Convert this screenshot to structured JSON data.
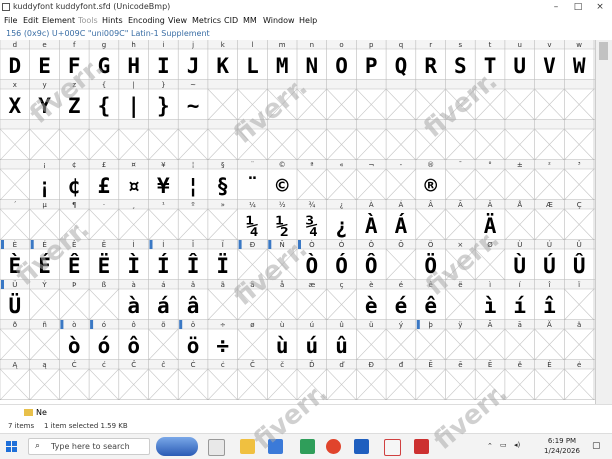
{
  "window": {
    "title": "kuddyfont  kuddyfont.sfd (UnicodeBmp)",
    "controls": [
      "–",
      "□",
      "×"
    ]
  },
  "menu": [
    "File",
    "Edit",
    "Element",
    "Tools",
    "Hints",
    "Encoding",
    "View",
    "Metrics",
    "CID",
    "MM",
    "Window",
    "Help"
  ],
  "info": "156 (0x9c) U+009C \"uni009C\" Latin-1 Supplement",
  "grid": {
    "rows": [
      {
        "labels": [
          "d",
          "e",
          "f",
          "g",
          "h",
          "i",
          "j",
          "k",
          "l",
          "m",
          "n",
          "o",
          "p",
          "q",
          "r",
          "s",
          "t",
          "u",
          "v",
          "w"
        ],
        "glyphs": [
          "D",
          "E",
          "F",
          "G",
          "H",
          "I",
          "J",
          "K",
          "L",
          "M",
          "N",
          "O",
          "P",
          "Q",
          "R",
          "S",
          "T",
          "U",
          "V",
          "W"
        ]
      },
      {
        "labels": [
          "x",
          "y",
          "z",
          "{",
          "|",
          "}",
          "~",
          "",
          "",
          "",
          "",
          "",
          "",
          "",
          "",
          "",
          "",
          "",
          "",
          ""
        ],
        "glyphs": [
          "X",
          "Y",
          "Z",
          "{",
          "|",
          "}",
          "~",
          "",
          "",
          "",
          "",
          "",
          "",
          "",
          "",
          "",
          "",
          "",
          "",
          ""
        ]
      },
      {
        "labels": [
          "",
          "",
          "",
          "",
          "",
          "",
          "",
          "",
          "",
          "",
          "",
          "",
          "",
          "",
          "",
          "",
          "",
          "",
          "",
          ""
        ],
        "glyphs": [
          "",
          "",
          "",
          "",
          "",
          "",
          "",
          "",
          "",
          "",
          "",
          "",
          "",
          "",
          "",
          "",
          "",
          "",
          "",
          ""
        ]
      },
      {
        "labels": [
          "",
          "¡",
          "¢",
          "£",
          "¤",
          "¥",
          "¦",
          "§",
          "¨",
          "©",
          "ª",
          "«",
          "¬",
          "-",
          "®",
          "¯",
          "°",
          "±",
          "²",
          "³"
        ],
        "glyphs": [
          "",
          "¡",
          "¢",
          "£",
          "¤",
          "¥",
          "¦",
          "§",
          "¨",
          "©",
          "",
          "",
          "",
          "",
          "®",
          "",
          "",
          "",
          "",
          ""
        ]
      },
      {
        "labels": [
          "´",
          "µ",
          "¶",
          "·",
          "¸",
          "¹",
          "º",
          "»",
          "¼",
          "½",
          "¾",
          "¿",
          "À",
          "Á",
          "Â",
          "Ã",
          "Ä",
          "Å",
          "Æ",
          "Ç"
        ],
        "glyphs": [
          "",
          "",
          "",
          "",
          "",
          "",
          "",
          "",
          "¼",
          "½",
          "¾",
          "¿",
          "À",
          "Á",
          "",
          "",
          "Ä",
          "",
          "",
          ""
        ]
      },
      {
        "labels": [
          "È",
          "É",
          "Ê",
          "Ë",
          "Ì",
          "Í",
          "Î",
          "Ï",
          "Ð",
          "Ñ",
          "Ò",
          "Ó",
          "Ô",
          "Õ",
          "Ö",
          "×",
          "Ø",
          "Ù",
          "Ú",
          "Û"
        ],
        "glyphs": [
          "È",
          "É",
          "Ê",
          "Ë",
          "Ì",
          "Í",
          "Î",
          "Ï",
          "",
          "",
          "Ò",
          "Ó",
          "Ô",
          "",
          "Ö",
          "",
          "",
          "Ù",
          "Ú",
          "Û"
        ]
      },
      {
        "labels": [
          "Ü",
          "Ý",
          "Þ",
          "ß",
          "à",
          "á",
          "â",
          "ã",
          "ä",
          "å",
          "æ",
          "ç",
          "è",
          "é",
          "ê",
          "ë",
          "ì",
          "í",
          "î",
          "ï"
        ],
        "glyphs": [
          "Ü",
          "",
          "",
          "",
          "à",
          "á",
          "â",
          "",
          "",
          "",
          "",
          "",
          "è",
          "é",
          "ê",
          "",
          "ì",
          "í",
          "î",
          ""
        ]
      },
      {
        "labels": [
          "ð",
          "ñ",
          "ò",
          "ó",
          "ô",
          "õ",
          "ö",
          "÷",
          "ø",
          "ù",
          "ú",
          "û",
          "ü",
          "ý",
          "þ",
          "ÿ",
          "Ā",
          "ā",
          "Ă",
          "ă"
        ],
        "glyphs": [
          "",
          "",
          "ò",
          "ó",
          "ô",
          "",
          "ö",
          "÷",
          "",
          "ù",
          "ú",
          "û",
          "",
          "",
          "",
          "",
          "",
          "",
          "",
          ""
        ]
      },
      {
        "labels": [
          "Ą",
          "ą",
          "Ć",
          "ć",
          "Ĉ",
          "ĉ",
          "Ċ",
          "ċ",
          "Č",
          "č",
          "Ď",
          "ď",
          "Đ",
          "đ",
          "Ē",
          "ē",
          "Ĕ",
          "ĕ",
          "Ė",
          "ė"
        ],
        "glyphs": [
          "",
          "",
          "",
          "",
          "",
          "",
          "",
          "",
          "",
          "",
          "",
          "",
          "",
          "",
          "",
          "",
          "",
          "",
          "",
          ""
        ]
      }
    ],
    "empty_mark": "×",
    "marked_color": "#3a78c4"
  },
  "folder": {
    "name": "Ne"
  },
  "statusbar": {
    "items": "7 items",
    "selected": "1 item selected  1.59 KB"
  },
  "taskbar": {
    "search_placeholder": "Type here to search",
    "time": "6:19 PM",
    "date": "1/24/2026"
  },
  "watermark": "fiverr."
}
